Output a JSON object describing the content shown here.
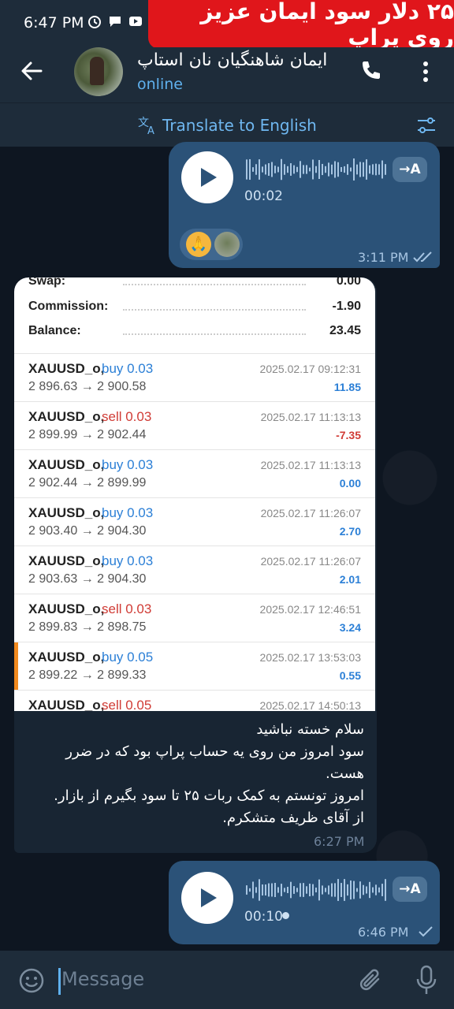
{
  "status_bar": {
    "time": "6:47 PM"
  },
  "banner": {
    "text": "۲۵ دلار سود ایمان عزیز روی پراپ"
  },
  "header": {
    "title": "ایمان شاهنگیان نان استاپ",
    "status": "online"
  },
  "translate_bar": {
    "label": "Translate to English"
  },
  "messages": {
    "voice1": {
      "duration": "00:02",
      "time": "3:11 PM",
      "translate_label": "→A",
      "reaction_emoji": "🙏"
    },
    "voice2": {
      "duration": "00:10",
      "time": "6:46 PM",
      "translate_label": "→A"
    },
    "photo": {
      "summary": [
        {
          "label": "Swap:",
          "value": "0.00"
        },
        {
          "label": "Commission:",
          "value": "-1.90"
        },
        {
          "label": "Balance:",
          "value": "23.45"
        }
      ],
      "trades": [
        {
          "symbol": "XAUUSD_o,",
          "side": "buy 0.03",
          "prices": "2 896.63 → 2 900.58",
          "date": "2025.02.17 09:12:31",
          "profit": "11.85"
        },
        {
          "symbol": "XAUUSD_o,",
          "side": "sell 0.03",
          "prices": "2 899.99 → 2 902.44",
          "date": "2025.02.17 11:13:13",
          "profit": "-7.35"
        },
        {
          "symbol": "XAUUSD_o,",
          "side": "buy 0.03",
          "prices": "2 902.44 → 2 899.99",
          "date": "2025.02.17 11:13:13",
          "profit": "0.00"
        },
        {
          "symbol": "XAUUSD_o,",
          "side": "buy 0.03",
          "prices": "2 903.40 → 2 904.30",
          "date": "2025.02.17 11:26:07",
          "profit": "2.70"
        },
        {
          "symbol": "XAUUSD_o,",
          "side": "buy 0.03",
          "prices": "2 903.63 → 2 904.30",
          "date": "2025.02.17 11:26:07",
          "profit": "2.01"
        },
        {
          "symbol": "XAUUSD_o,",
          "side": "sell 0.03",
          "prices": "2 899.83 → 2 898.75",
          "date": "2025.02.17 12:46:51",
          "profit": "3.24"
        },
        {
          "symbol": "XAUUSD_o,",
          "side": "buy 0.05",
          "prices": "2 899.22 → 2 899.33",
          "date": "2025.02.17 13:53:03",
          "profit": "0.55"
        },
        {
          "symbol": "XAUUSD_o,",
          "side": "sell 0.05",
          "prices": "",
          "date": "2025.02.17 14:50:13",
          "profit": ""
        }
      ],
      "caption_lines": [
        "سلام خسته نباشید",
        "سود امروز من روی یه حساب پراپ بود که در ضرر هست.",
        "امروز تونستم به کمک ربات ۲۵ تا سود بگیرم از بازار.",
        "از آقای ظریف متشکرم."
      ],
      "time": "6:27 PM"
    }
  },
  "input": {
    "placeholder": "Message"
  },
  "colors": {
    "accent": "#5fb1ee",
    "bubble_out": "#2b5278",
    "bubble_in": "#182533",
    "background": "#0e1621",
    "banner": "#e0161b"
  }
}
